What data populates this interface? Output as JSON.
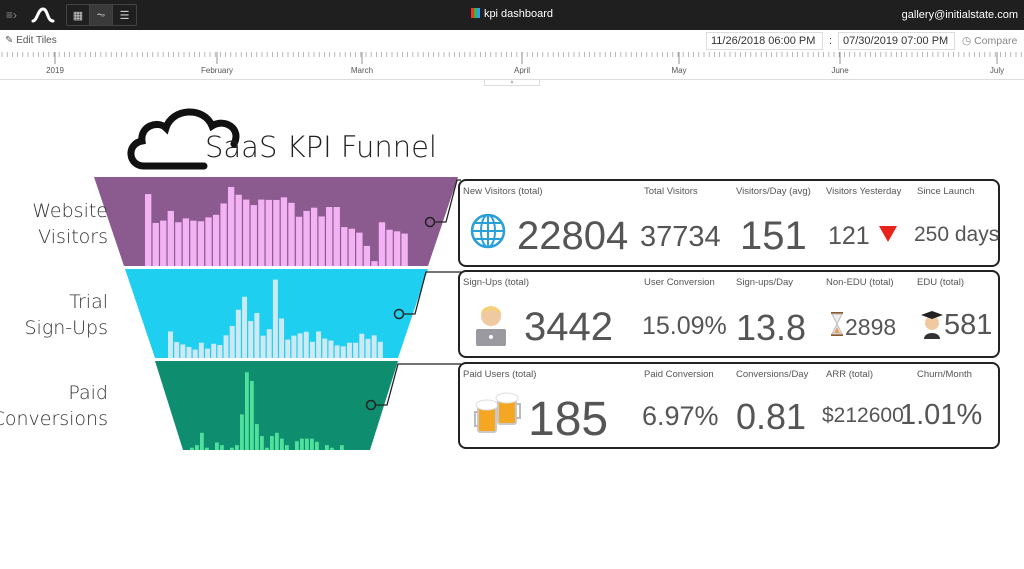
{
  "topbar": {
    "title": "kpi dashboard",
    "user": "gallery@initialstate.com",
    "icons": [
      "menu-icon",
      "initialstate-logo",
      "tiles-view-icon",
      "waves-view-icon",
      "lines-view-icon",
      "chart-icon"
    ]
  },
  "toolbar": {
    "edit_label": "Edit Tiles",
    "start_date": "11/26/2018 06:00 PM",
    "end_date": "07/30/2019 07:00 PM",
    "separator": ":",
    "compare_label": "Compare"
  },
  "timeline": {
    "labels": [
      "2019",
      "February",
      "March",
      "April",
      "May",
      "June",
      "July"
    ]
  },
  "dashboard": {
    "title": "SaaS KPI Funnel",
    "stages": [
      {
        "label1": "Website",
        "label2": "Visitors",
        "color": "#8b5a8f",
        "bar_color": "#f3b2f3",
        "bars": [
          222,
          133,
          140,
          170,
          135,
          147,
          140,
          138,
          150,
          158,
          193,
          244,
          220,
          205,
          188,
          205,
          204,
          204,
          212,
          195,
          152,
          170,
          180,
          153,
          182,
          182,
          120,
          115,
          103,
          62,
          15,
          135,
          112,
          107,
          100
        ]
      },
      {
        "label1": "Trial",
        "label2": "Sign-Ups",
        "color": "#1ecff0",
        "bar_color": "#cde9f3",
        "bars": [
          82,
          49,
          42,
          34,
          26,
          47,
          29,
          44,
          40,
          70,
          99,
          149,
          189,
          114,
          139,
          69,
          89,
          242,
          122,
          57,
          69,
          76,
          81,
          50,
          82,
          60,
          54,
          39,
          36,
          47,
          47,
          75,
          59,
          70,
          50
        ]
      },
      {
        "label1": "Paid",
        "label2": "Conversions",
        "color": "#0e8e6e",
        "bar_color": "#4fe09c",
        "bars": [
          7,
          15,
          53,
          7,
          0,
          23,
          15,
          0,
          7,
          15,
          110,
          240,
          213,
          80,
          43,
          7,
          43,
          53,
          35,
          15,
          0,
          27,
          35,
          35,
          35,
          25,
          0,
          15,
          7,
          0,
          15,
          0,
          0,
          0,
          0
        ]
      }
    ],
    "panels": [
      {
        "icon": "globe-icon",
        "metrics": [
          {
            "label": "New Visitors (total)",
            "value": "22804"
          },
          {
            "label": "Total Visitors",
            "value": "37734"
          },
          {
            "label": "Visitors/Day (avg)",
            "value": "151"
          },
          {
            "label": "Visitors Yesterday",
            "value": "121",
            "trend": "down"
          },
          {
            "label": "Since Launch",
            "value": "250 days"
          }
        ]
      },
      {
        "icon": "person-laptop-icon",
        "metrics": [
          {
            "label": "Sign-Ups (total)",
            "value": "3442"
          },
          {
            "label": "User Conversion",
            "value": "15.09%"
          },
          {
            "label": "Sign-ups/Day",
            "value": "13.8"
          },
          {
            "label": "Non-EDU (total)",
            "value": "2898",
            "icon": "hourglass-icon"
          },
          {
            "label": "EDU (total)",
            "value": "581",
            "icon": "graduate-icon"
          }
        ]
      },
      {
        "icon": "beer-mugs-icon",
        "metrics": [
          {
            "label": "Paid Users (total)",
            "value": "185"
          },
          {
            "label": "Paid Conversion",
            "value": "6.97%"
          },
          {
            "label": "Conversions/Day",
            "value": "0.81"
          },
          {
            "label": "ARR (total)",
            "value": "$212600"
          },
          {
            "label": "Churn/Month",
            "value": "1.01%"
          }
        ]
      }
    ]
  }
}
